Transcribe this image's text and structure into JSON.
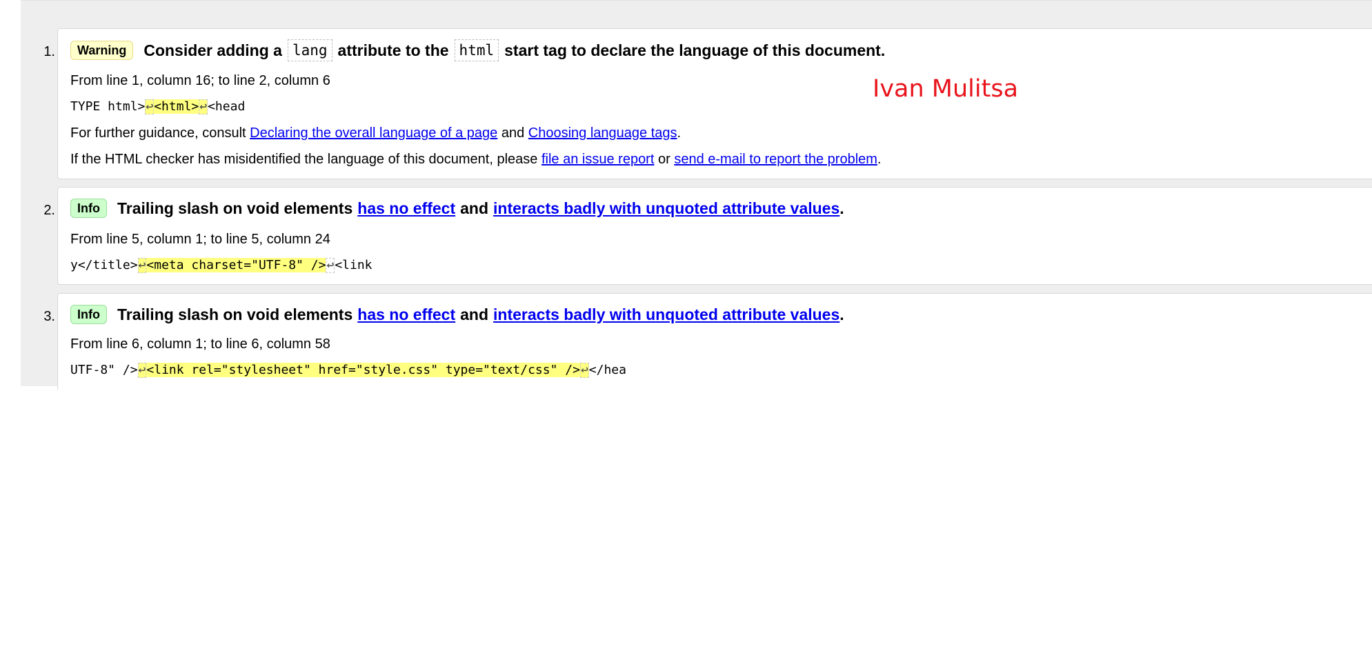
{
  "messages": [
    {
      "number": "1.",
      "type": "Warning",
      "heading": {
        "p1": "Consider adding a",
        "code1": "lang",
        "p2": "attribute to the",
        "code2": "html",
        "p3": "start tag to declare the language of this document."
      },
      "location": "From line 1, column 16; to line 2, column 6",
      "extract": {
        "pre": "TYPE html>",
        "lf1": "↩",
        "hl": "<html>",
        "lf2": "↩",
        "post": "<head"
      },
      "guidance": {
        "prefix": "For further guidance, consult",
        "link1": "Declaring the overall language of a page",
        "mid": "and",
        "link2": "Choosing language tags",
        "suffix": "."
      },
      "misidentified": {
        "prefix": "If the HTML checker has misidentified the language of this document, please",
        "link1": "file an issue report",
        "mid": "or",
        "link2": "send e-mail to report the problem",
        "suffix": "."
      }
    },
    {
      "number": "2.",
      "type": "Info",
      "heading": {
        "p1": "Trailing slash on void elements",
        "link1": "has no effect",
        "mid": "and",
        "link2": "interacts badly with unquoted attribute values",
        "suffix": "."
      },
      "location": "From line 5, column 1; to line 5, column 24",
      "extract": {
        "pre": "y</title>",
        "lf1": "↩",
        "hl": "<meta charset=\"UTF-8\" />",
        "lf2": "↩",
        "post": "<link"
      }
    },
    {
      "number": "3.",
      "type": "Info",
      "heading": {
        "p1": "Trailing slash on void elements",
        "link1": "has no effect",
        "mid": "and",
        "link2": "interacts badly with unquoted attribute values",
        "suffix": "."
      },
      "location": "From line 6, column 1; to line 6, column 58",
      "extract": {
        "pre": "UTF-8\" />",
        "lf1": "↩",
        "hl": "<link rel=\"stylesheet\" href=\"style.css\" type=\"text/css\" />",
        "lf2": "↩",
        "post": "</hea"
      }
    }
  ],
  "watermark": "Ivan Mulitsa",
  "colors": {
    "warning_badge": "#ffffcc",
    "info_badge": "#ccffcc",
    "highlight": "#ffff80",
    "link": "#0000ee",
    "watermark": "#e8141c"
  }
}
